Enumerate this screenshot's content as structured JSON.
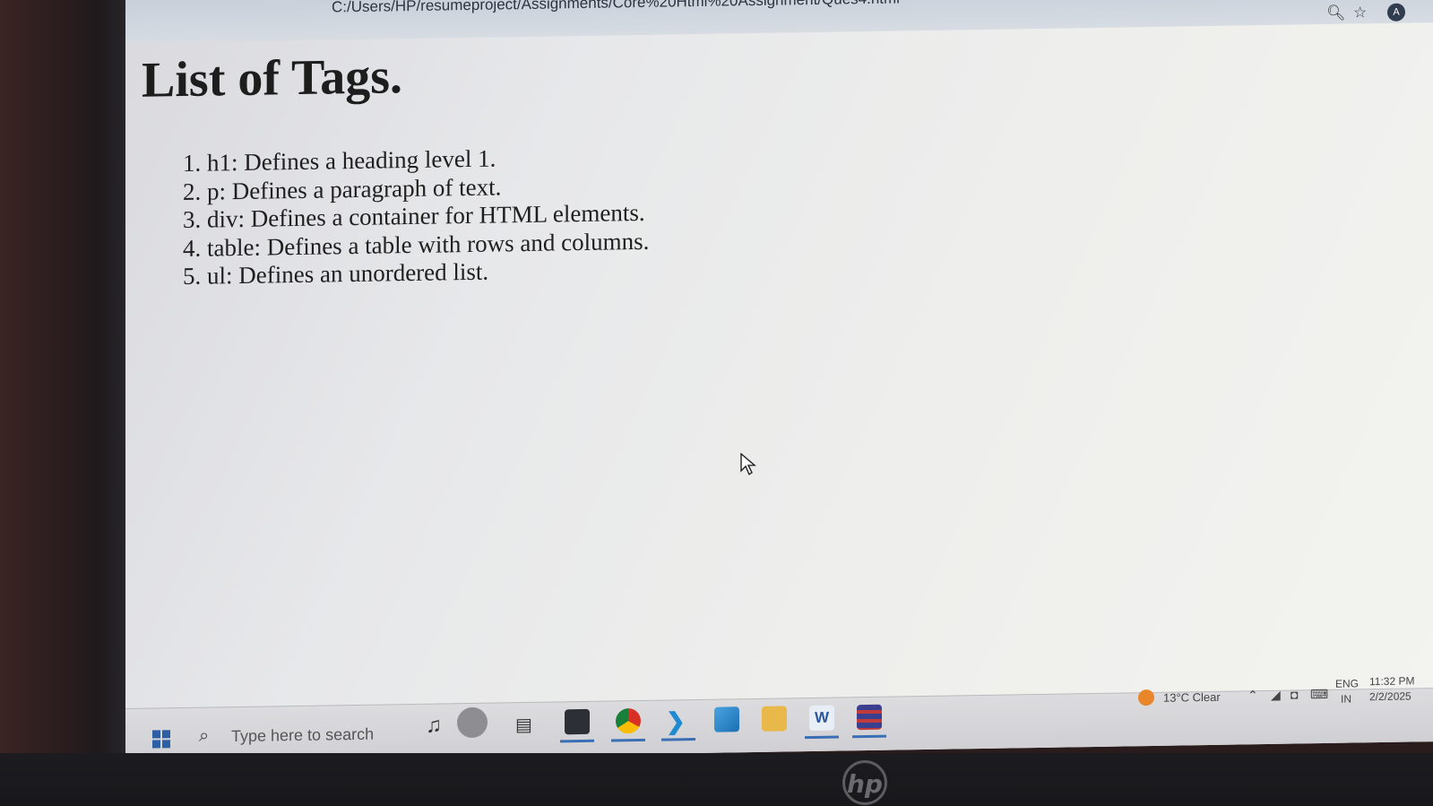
{
  "browser": {
    "url": "C:/Users/HP/resumeproject/Assignments/Core%20Html%20Assignment/Ques4.html",
    "profile_initial": "A"
  },
  "page": {
    "title": "List of Tags.",
    "items": [
      "h1: Defines a heading level 1.",
      "p: Defines a paragraph of text.",
      "div: Defines a container for HTML elements.",
      "table: Defines a table with rows and columns.",
      "ul: Defines an unordered list."
    ]
  },
  "taskbar": {
    "search_placeholder": "Type here to search",
    "weather": "13°C  Clear",
    "language": "ENG",
    "region": "IN",
    "time": "11:32 PM",
    "date": "2/2/2025",
    "hardware_logo": "hp"
  },
  "colors": {
    "screen_bg": "#eeeeec",
    "text": "#1f1f1f",
    "taskbar": "#d6d6da",
    "accent": "#3a6fb5"
  }
}
